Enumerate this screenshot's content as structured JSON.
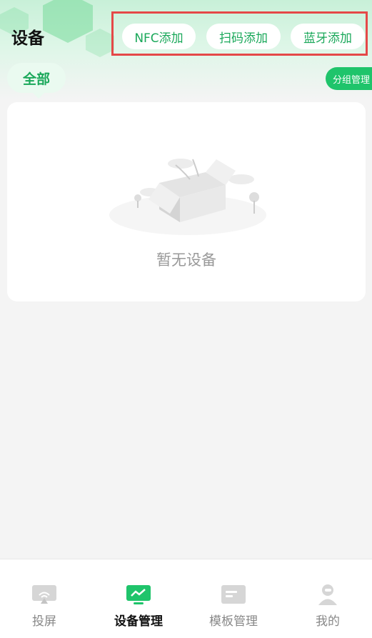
{
  "header": {
    "title": "设备",
    "add_buttons": [
      "NFC添加",
      "扫码添加",
      "蓝牙添加"
    ]
  },
  "filter": {
    "active_tab": "全部",
    "group_manage": "分组管理"
  },
  "empty_state": {
    "message": "暂无设备"
  },
  "tabbar": [
    {
      "label": "投屏",
      "icon": "screen-cast-icon",
      "active": false
    },
    {
      "label": "设备管理",
      "icon": "device-monitor-icon",
      "active": true
    },
    {
      "label": "模板管理",
      "icon": "template-icon",
      "active": false
    },
    {
      "label": "我的",
      "icon": "profile-icon",
      "active": false
    }
  ],
  "colors": {
    "accent": "#1aa85a",
    "accent_bright": "#1fc46b",
    "highlight_border": "#e54848"
  }
}
